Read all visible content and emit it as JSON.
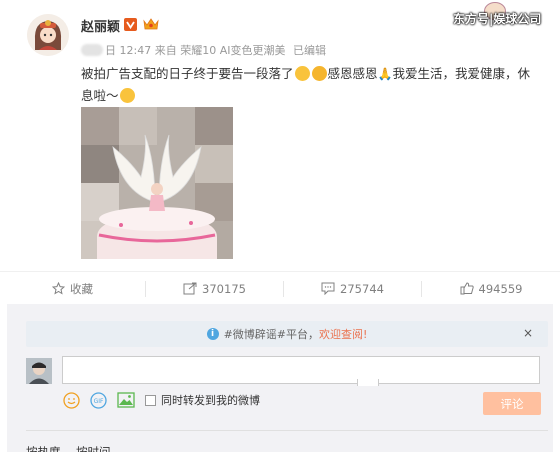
{
  "post": {
    "username": "赵丽颖",
    "verified_color": "#e65b1e",
    "watermark": "东方号|娱球公司",
    "meta": {
      "date_suffix": "日",
      "time": "12:47",
      "source_prefix": "来自",
      "source": "荣耀10 AI变色更潮美",
      "edited": "已编辑"
    },
    "text_part1": "被拍广告支配的日子终于要告一段落了",
    "text_part2": "感恩感恩",
    "text_part3": "我爱生活，我爱健康，休息啦～",
    "image_description_icon": "cake-photo"
  },
  "actions": {
    "favorite_label": "收藏",
    "repost_count": "370175",
    "comment_count": "275744",
    "like_count": "494559"
  },
  "comment_box": {
    "notice_prefix": "#微博辟谣#平台，",
    "notice_link": "欢迎查阅!",
    "close_symbol": "×",
    "repost_option": "同时转发到我的微博",
    "submit_label": "评论"
  },
  "sort": {
    "hot_label": "按热度",
    "time_label": "按时间"
  },
  "colors": {
    "accent": "#eb7350",
    "submit_disabled": "#ffc09f",
    "info_blue": "#4fa6e0"
  }
}
